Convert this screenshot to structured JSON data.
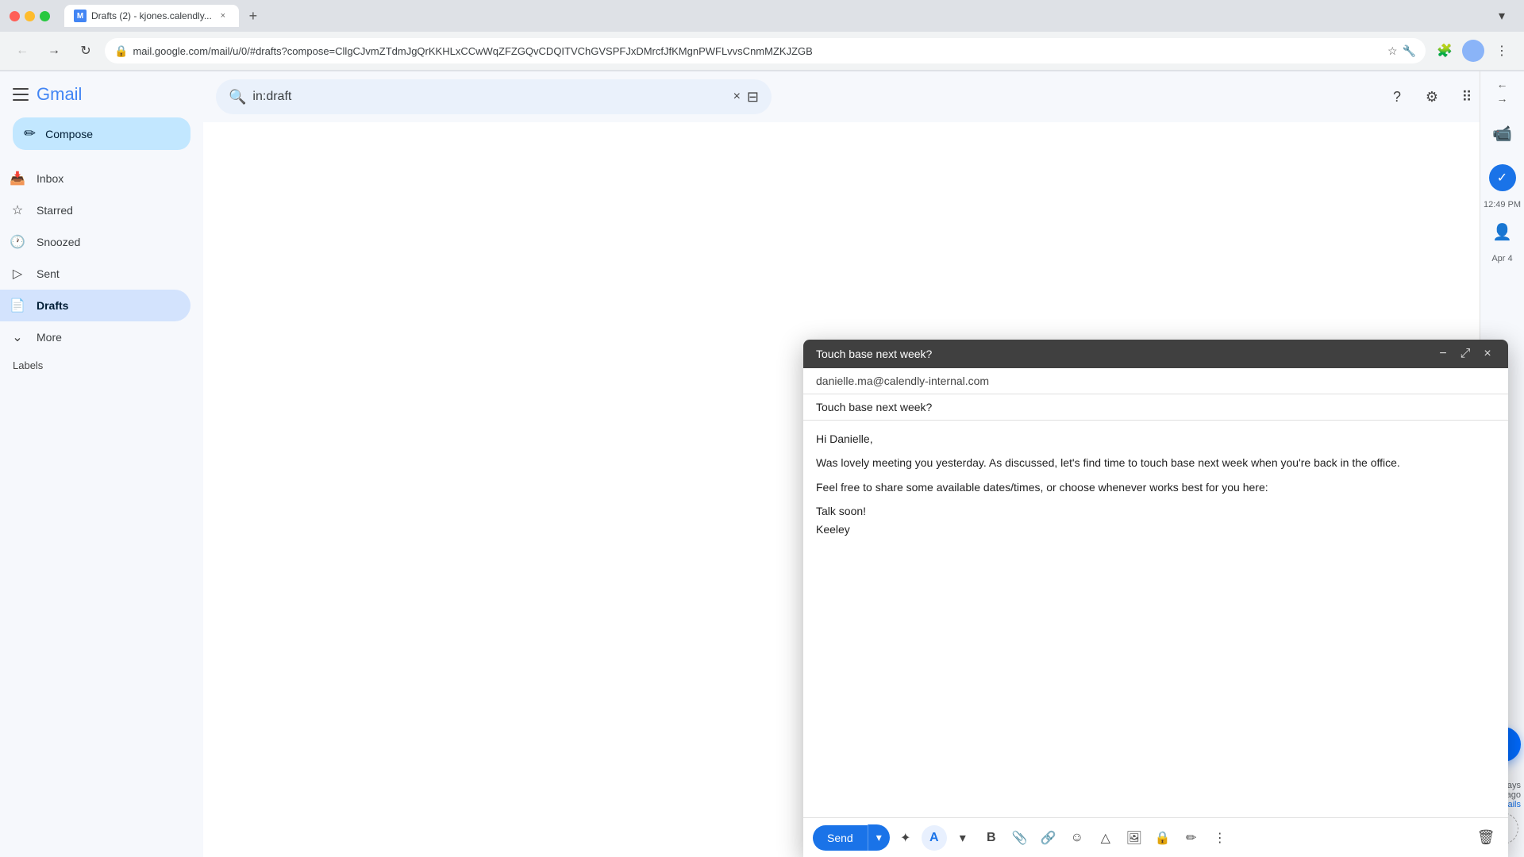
{
  "browser": {
    "tab_title": "Drafts (2) - kjones.calendly...",
    "tab_favicon": "M",
    "url": "mail.google.com/mail/u/0/#drafts?compose=CllgCJvmZTdmJgQrKKHLxCCwWqZFZGQvCDQITVChGVSPFJxDMrcfJfKMgnPWFLvvsCnmMZKJZGB",
    "add_tab_label": "+",
    "dropdown_label": "▾"
  },
  "gmail": {
    "search_placeholder": "in:draft",
    "search_value": "in:draft",
    "logo_text": "Gmail"
  },
  "sidebar": {
    "compose_label": "Compose",
    "items": [
      {
        "id": "inbox",
        "label": "Inbox",
        "icon": "📥",
        "count": ""
      },
      {
        "id": "starred",
        "label": "Starred",
        "icon": "☆",
        "count": ""
      },
      {
        "id": "snoozed",
        "label": "Snoozed",
        "icon": "🕐",
        "count": ""
      },
      {
        "id": "sent",
        "label": "Sent",
        "icon": "▷",
        "count": ""
      },
      {
        "id": "drafts",
        "label": "Drafts",
        "icon": "📄",
        "count": ""
      },
      {
        "id": "more",
        "label": "More",
        "icon": "⌄",
        "count": ""
      }
    ],
    "labels_section": "Labels"
  },
  "compose": {
    "title": "Touch base next week?",
    "to": "danielle.ma@calendly-internal.com",
    "subject": "Touch base next week?",
    "body_lines": [
      "Hi Danielle,",
      "",
      "Was lovely meeting you yesterday. As discussed, let's find time to touch base next week when you're back in the office.",
      "",
      "Feel free to share some available dates/times, or choose whenever works best for you here:",
      "",
      "Talk soon!",
      "Keeley"
    ],
    "send_label": "Send",
    "toolbar_buttons": [
      {
        "id": "formatting",
        "icon": "✦",
        "title": "Formatting options"
      },
      {
        "id": "font-color",
        "icon": "A",
        "title": "Font color",
        "active": true
      },
      {
        "id": "bold",
        "icon": "B",
        "title": "Bold"
      },
      {
        "id": "attach",
        "icon": "📎",
        "title": "Attach files"
      },
      {
        "id": "link",
        "icon": "🔗",
        "title": "Insert link"
      },
      {
        "id": "emoji",
        "icon": "😊",
        "title": "Insert emoji"
      },
      {
        "id": "drive",
        "icon": "△",
        "title": "Insert from Drive"
      },
      {
        "id": "photo",
        "icon": "🖼",
        "title": "Insert photo"
      },
      {
        "id": "lock",
        "icon": "🔒",
        "title": "Confidential mode"
      },
      {
        "id": "signature",
        "icon": "✏",
        "title": "Insert signature"
      },
      {
        "id": "more",
        "icon": "⋮",
        "title": "More options"
      }
    ],
    "delete_label": "🗑"
  },
  "right_panel": {
    "items": [
      {
        "id": "meet",
        "icon": "📹",
        "timestamp": ""
      },
      {
        "id": "tasks",
        "icon": "✓",
        "timestamp": "12:49 PM"
      },
      {
        "id": "contacts",
        "icon": "👤",
        "timestamp": "Apr 4"
      }
    ],
    "add_label": "+",
    "calendly_icon": "●"
  }
}
